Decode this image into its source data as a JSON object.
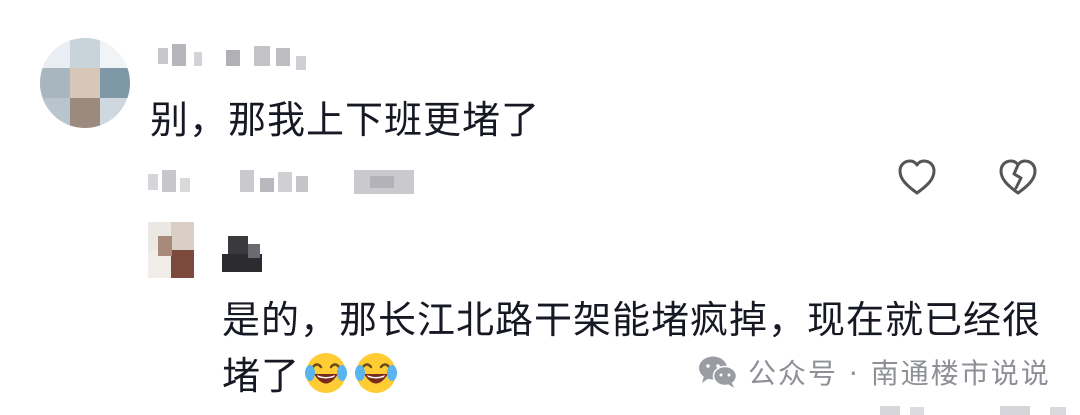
{
  "comment": {
    "author_blurred": true,
    "text": "别，那我上下班更堵了",
    "meta_blurred": true,
    "actions": {
      "like_icon": "heart-outline-icon",
      "dislike_icon": "broken-heart-icon"
    }
  },
  "reply": {
    "author_blurred": true,
    "text": "是的，那长江北路干架能堵疯掉，现在就已经很堵了",
    "emojis": [
      "face-with-tears-of-joy",
      "face-with-tears-of-joy"
    ]
  },
  "watermark": {
    "icon": "wechat-icon",
    "text": "公众号 · 南通楼市说说"
  },
  "colors": {
    "text": "#161823",
    "watermark": "#8e9097",
    "icon": "#555555"
  }
}
